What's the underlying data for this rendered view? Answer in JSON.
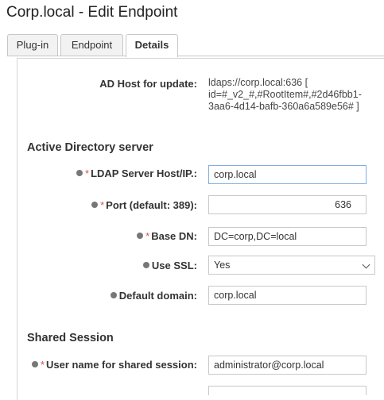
{
  "page": {
    "title": "Corp.local - Edit Endpoint"
  },
  "tabs": [
    {
      "label": "Plug-in"
    },
    {
      "label": "Endpoint"
    },
    {
      "label": "Details"
    }
  ],
  "details": {
    "ad_host_label": "AD Host for update:",
    "ad_host_value": "ldaps://corp.local:636 [ id=#_v2_#,#RootItem#,#2d46fbb1-3aa6-4d14-bafb-360a6a589e56# ]"
  },
  "ad_server": {
    "section_title": "Active Directory server",
    "ldap_host": {
      "label": "LDAP Server Host/IP.:",
      "value": "corp.local"
    },
    "port": {
      "label": "Port (default: 389):",
      "value": "636"
    },
    "base_dn": {
      "label": "Base DN:",
      "value": "DC=corp,DC=local"
    },
    "use_ssl": {
      "label": "Use SSL:",
      "value": "Yes"
    },
    "default_domain": {
      "label": "Default domain:",
      "value": "corp.local"
    }
  },
  "shared_session": {
    "section_title": "Shared Session",
    "username": {
      "label": "User name for shared session:",
      "value": "administrator@corp.local"
    }
  },
  "required_marker": "*"
}
